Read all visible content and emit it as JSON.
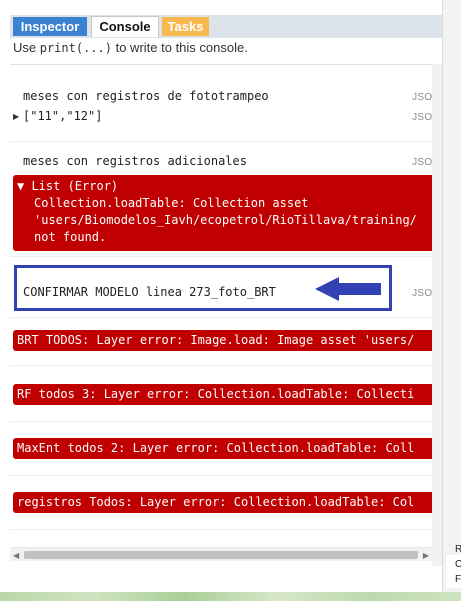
{
  "tabs": [
    {
      "label": "Inspector",
      "color": "#3b82d1"
    },
    {
      "label": "Console",
      "active": true
    },
    {
      "label": "Tasks",
      "color": "#f7b84f"
    }
  ],
  "hint": {
    "prefix": "Use ",
    "code": "print(...)",
    "suffix": " to write to this console."
  },
  "console": {
    "json_tag": "JSON",
    "entries": {
      "meses_fototrampeo": {
        "label": "meses con registros de fototrampeo",
        "value": "[\"11\",\"12\"]"
      },
      "meses_adicionales": {
        "label": "meses con registros adicionales"
      },
      "list_error": {
        "head": "List (Error)",
        "lines": [
          "Collection.loadTable: Collection asset",
          "'users/Biomodelos_Iavh/ecopetrol/RioTillava/training/",
          "not found."
        ]
      },
      "confirmar": {
        "label": "CONFIRMAR MODELO linea 273_foto_BRT"
      },
      "errors": [
        "BRT TODOS: Layer error: Image.load: Image asset 'users/",
        "RF todos 3: Layer error: Collection.loadTable: Collecti",
        "MaxEnt todos 2: Layer error: Collection.loadTable: Coll",
        "registros Todos: Layer error: Collection.loadTable: Col"
      ]
    },
    "error_color": "#c00000",
    "highlight_color": "#3242b4"
  },
  "right_pane": {
    "letters": [
      "R",
      "C",
      "F"
    ]
  }
}
